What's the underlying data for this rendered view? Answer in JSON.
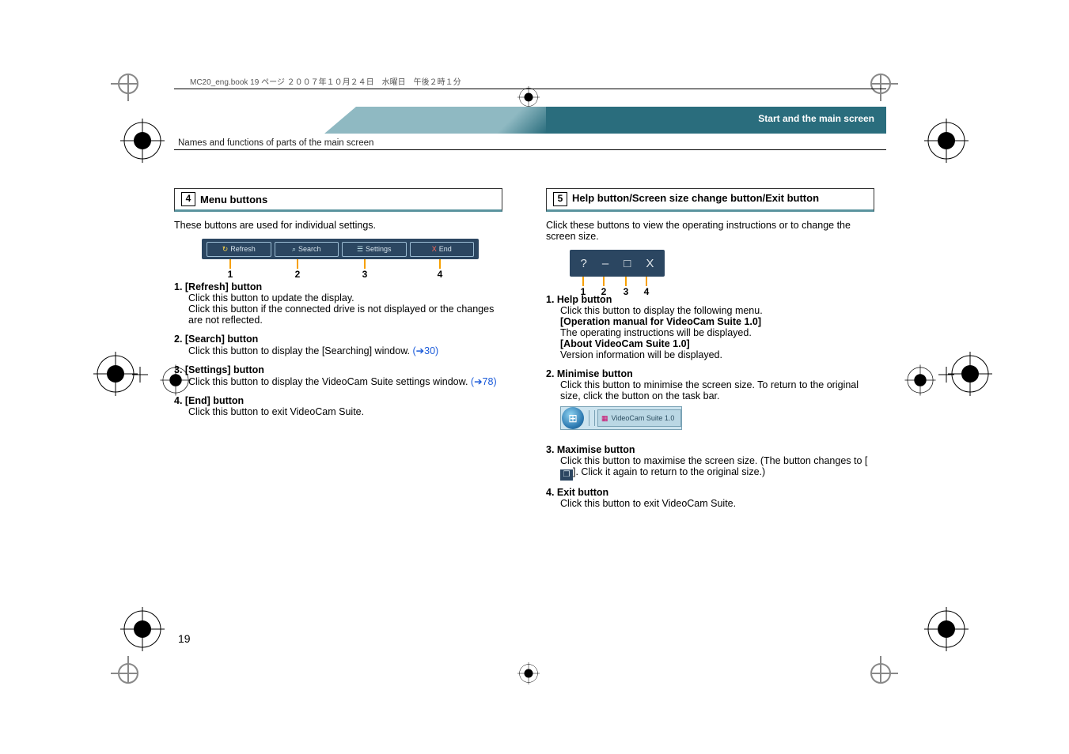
{
  "headerLine": "MC20_eng.book  19 ページ  ２００７年１０月２４日　水曜日　午後２時１分",
  "chapterBanner": "Start and the main screen",
  "subheader": "Names and functions of parts of the main screen",
  "left": {
    "boxNum": "4",
    "title": "Menu buttons",
    "intro": "These buttons are used for individual settings.",
    "btn1": "Refresh",
    "btn2": "Search",
    "btn3": "Settings",
    "btn4x": "X",
    "btn4": "End",
    "c1": "1",
    "c2": "2",
    "c3": "3",
    "c4": "4",
    "item1_title": "1. [Refresh] button",
    "item1_body1": "Click this button to update the display.",
    "item1_body2": "Click this button if the connected drive is not displayed or the changes are not reflected.",
    "item2_title": "2. [Search] button",
    "item2_body": "Click this button to display the [Searching] window. ",
    "item2_link": "(➔30)",
    "item3_title": "3. [Settings] button",
    "item3_body": "Click this button to display the VideoCam Suite settings window. ",
    "item3_link": "(➔78)",
    "item4_title": "4. [End] button",
    "item4_body": "Click this button to exit VideoCam Suite."
  },
  "right": {
    "boxNum": "5",
    "title": "Help button/Screen size change button/Exit button",
    "intro": "Click these buttons to view the operating instructions or to change the screen size.",
    "hb1": "?",
    "hb2": "–",
    "hb3": "□",
    "hb4": "X",
    "c1": "1",
    "c2": "2",
    "c3": "3",
    "c4": "4",
    "item1_title": "1. Help button",
    "item1_body1": "Click this button to display the following menu.",
    "item1_bold1": "[Operation manual for VideoCam Suite 1.0]",
    "item1_body2": "The operating instructions will be displayed.",
    "item1_bold2": "[About VideoCam Suite 1.0]",
    "item1_body3": "Version information will be displayed.",
    "item2_title": "2. Minimise button",
    "item2_body": "Click this button to minimise the screen size. To return to the original size, click the button on the task bar.",
    "taskbtn": "VideoCam Suite 1.0",
    "item3_title": "3. Maximise button",
    "item3_body1": "Click this button to maximise the screen size. (The button changes to [",
    "item3_body2": "]. Click it again to return to the original size.)",
    "restoreIcon": "❐",
    "item4_title": "4. Exit button",
    "item4_body": "Click this button to exit VideoCam Suite."
  },
  "pageNumber": "19"
}
